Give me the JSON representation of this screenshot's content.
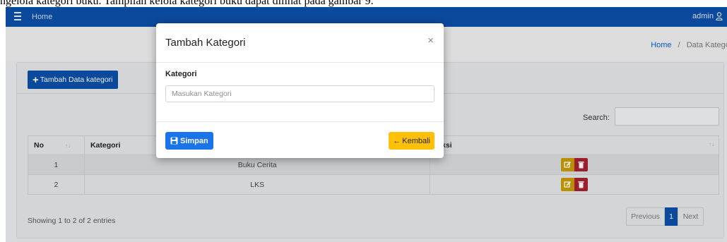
{
  "document": {
    "caption": "ngelola kategori buku. Tampilan kelola kategori buku dapat dilihat pada gambar 9."
  },
  "topbar": {
    "home_label": "Home",
    "user_label": "admin"
  },
  "breadcrumb": {
    "home": "Home",
    "separator": "/",
    "current": "Data Kategori"
  },
  "card": {
    "add_button_label": "Tambah Data kategori",
    "search_label": "Search:"
  },
  "table": {
    "headers": [
      "No",
      "Kategori",
      "Aksi"
    ],
    "rows": [
      {
        "no": "1",
        "kategori": "Buku Cerita"
      },
      {
        "no": "2",
        "kategori": "LKS"
      }
    ]
  },
  "footer": {
    "showing": "Showing 1 to 2 of 2 entries",
    "prev_label": "Previous",
    "current_page": "1",
    "next_label": "Next"
  },
  "modal": {
    "title": "Tambah Kategori",
    "close_symbol": "×",
    "field_label": "Kategori",
    "field_placeholder": "Masukan Kategori",
    "field_value": "",
    "save_label": "Simpan",
    "back_label": "Kembali"
  },
  "colors": {
    "navbar": "#0b4fa8",
    "primary": "#1a73e8",
    "warning": "#ffc107",
    "danger": "#a82131",
    "edit": "#c79b00"
  }
}
